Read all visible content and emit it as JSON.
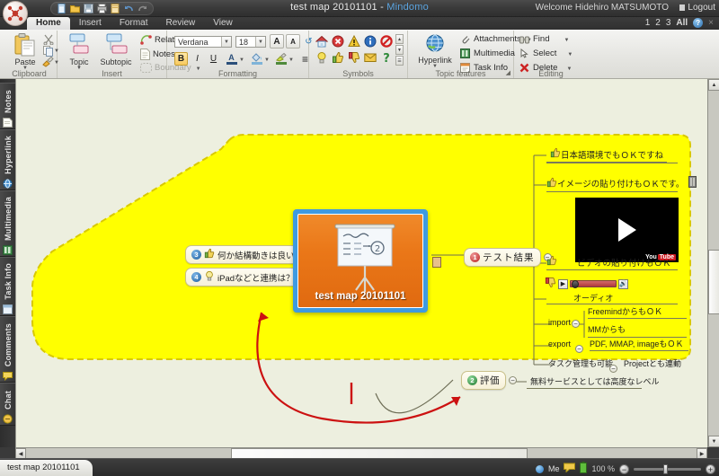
{
  "window": {
    "title_main": "test map 20101101 - ",
    "title_brand": "Mindomo",
    "welcome": "Welcome Hidehiro MATSUMOTO",
    "logout": "Logout"
  },
  "quick_access": {
    "items": [
      {
        "name": "new-icon",
        "glyph": "▭"
      },
      {
        "name": "open-folder-icon",
        "glyph": "▬"
      },
      {
        "name": "save-icon",
        "glyph": "▤"
      },
      {
        "name": "print-icon",
        "glyph": "⎙"
      },
      {
        "name": "export-icon",
        "glyph": "▥"
      },
      {
        "name": "undo-icon",
        "glyph": "↶"
      },
      {
        "name": "redo-icon",
        "glyph": "↷"
      }
    ]
  },
  "menu": {
    "tabs": [
      {
        "label": "Home",
        "active": true
      },
      {
        "label": "Insert",
        "active": false
      },
      {
        "label": "Format",
        "active": false
      },
      {
        "label": "Review",
        "active": false
      },
      {
        "label": "View",
        "active": false
      }
    ],
    "pages": [
      "1",
      "2",
      "3",
      "All"
    ],
    "help": "?",
    "close": "×"
  },
  "ribbon": {
    "groups": [
      {
        "title": "Clipboard"
      },
      {
        "title": "Insert"
      },
      {
        "title": "Formatting"
      },
      {
        "title": "Symbols"
      },
      {
        "title": "Topic features"
      },
      {
        "title": "Editing"
      }
    ],
    "clipboard": {
      "paste_label": "Paste",
      "cut_name": "cut-icon",
      "copy_name": "copy-icon",
      "format_painter_name": "format-painter-icon"
    },
    "insert": {
      "topic_label": "Topic",
      "subtopic_label": "Subtopic",
      "relationship_label": "Relationship",
      "notes_label": "Notes",
      "boundary_label": "Boundary"
    },
    "formatting": {
      "font_family": "Verdana",
      "font_size": "18",
      "grow_font": "A",
      "shrink_font": "A",
      "clear_format": "↺",
      "bold": "B",
      "italic": "I",
      "underline": "U",
      "font_color": "A",
      "fill_color": "◆",
      "highlight": "✐",
      "align": "≡"
    },
    "symbols": {
      "row1": [
        "home-symbol",
        "error-symbol",
        "warning-symbol",
        "info-symbol",
        "forbidden-symbol"
      ],
      "row2": [
        "idea-symbol",
        "thumbs-up-symbol",
        "thumbs-down-symbol",
        "mail-symbol",
        "question-symbol"
      ]
    },
    "topic_features": {
      "hyperlink_label": "Hyperlink",
      "attachments_label": "Attachments",
      "multimedia_label": "Multimedia",
      "task_info_label": "Task Info"
    },
    "editing": {
      "find_label": "Find",
      "select_label": "Select",
      "delete_label": "Delete"
    }
  },
  "sidebar": {
    "tabs": [
      {
        "label": "Notes",
        "icon": "notes-icon"
      },
      {
        "label": "Hyperlink",
        "icon": "hyperlink-icon"
      },
      {
        "label": "Multimedia",
        "icon": "multimedia-icon"
      },
      {
        "label": "Task Info",
        "icon": "task-info-icon"
      },
      {
        "label": "Comments",
        "icon": "comments-icon"
      },
      {
        "label": "Chat",
        "icon": "chat-icon"
      }
    ]
  },
  "map": {
    "central_topic": "test map 20101101",
    "left_nodes": [
      {
        "num": "3",
        "badge_color": "#1f6fc0",
        "icon": "thumbs-up-symbol",
        "text": "何か結構動きは良い"
      },
      {
        "num": "4",
        "badge_color": "#1f6fc0",
        "icon": "idea-symbol",
        "text": "iPadなどと連携は？"
      }
    ],
    "right_main": {
      "num": "1",
      "badge_color": "#d03a3a",
      "text": "テスト結果"
    },
    "right_children": [
      {
        "icon": "thumbs-up-symbol",
        "text": "日本語環境でもＯＫですね"
      },
      {
        "icon": "thumbs-up-symbol",
        "text": "イメージの貼り付けもＯＫです。",
        "attachment": "image-attachment-icon"
      },
      {
        "icon": "thumbs-up-symbol",
        "text": "ビデオの貼り付けもＯＫ",
        "media": "youtube-video"
      },
      {
        "icon": "thumbs-down-symbol",
        "text": "オーディオ",
        "media": "audio-player"
      }
    ],
    "import_label": "import",
    "import_children": [
      "FreemindからもＯＫ",
      "MMからも"
    ],
    "export_label": "export",
    "export_children": [
      "PDF, MMAP, imageもＯＫ"
    ],
    "task_label": "タスク管理も可能",
    "task_children": [
      "Projectとも連動"
    ],
    "bottom_node": {
      "num": "2",
      "badge_color": "#2f8a3a",
      "text": "評価"
    },
    "bottom_child": "無料サービスとしては高度なレベル",
    "youtube": {
      "you": "You",
      "tube": "Tube"
    }
  },
  "statusbar": {
    "doc_tab": "test map 20101101",
    "me_label": "Me",
    "zoom_level": "100 %",
    "zoom_out": "−",
    "zoom_in": "+"
  },
  "colors": {
    "accent_orange": "#ea7718",
    "select_blue": "#3f9ae0",
    "boundary_yellow": "#ffff00",
    "canvas": "#edefdf",
    "relationship_red": "#cc1111"
  }
}
